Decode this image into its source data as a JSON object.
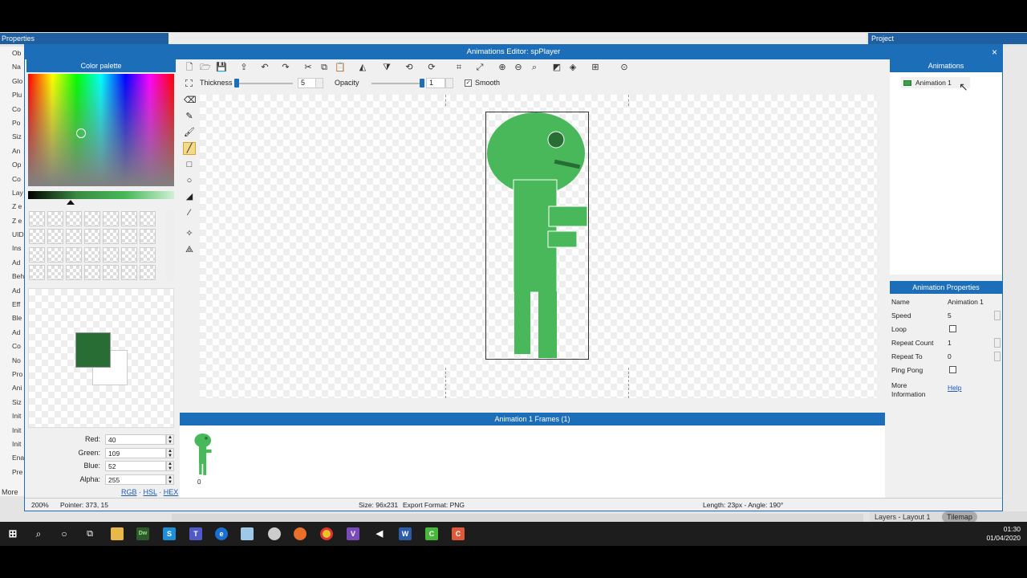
{
  "background": {
    "properties_title": "Properties",
    "project_title": "Project",
    "property_list": [
      "Ob",
      "Na",
      "Glo",
      "Plu",
      "Co",
      "Po",
      "Siz",
      "An",
      "Op",
      "Co",
      "Lay",
      "Z e",
      "Z e",
      "UID",
      "Ins",
      "Ad",
      "Beh",
      "Ad",
      "Eff",
      "Ble",
      "Ad",
      "Co",
      "No",
      "Pro",
      "Ani",
      "Siz",
      "Init",
      "Init",
      "Init",
      "Ena",
      "Pre"
    ],
    "more_label": "More",
    "layers_tab": "Layers - Layout 1",
    "tilemap_tab": "Tilemap"
  },
  "dialog": {
    "title": "Animations Editor: spPlayer",
    "close_glyph": "×"
  },
  "palette": {
    "title": "Color palette",
    "primary_color": "#286d34",
    "secondary_color": "#ffffff",
    "fields": [
      {
        "label": "Red:",
        "value": "40"
      },
      {
        "label": "Green:",
        "value": "109"
      },
      {
        "label": "Blue:",
        "value": "52"
      },
      {
        "label": "Alpha:",
        "value": "255"
      }
    ],
    "formats": [
      "RGB",
      "HSL",
      "HEX"
    ]
  },
  "options": {
    "thickness_label": "Thickness",
    "thickness_value": "5",
    "opacity_label": "Opacity",
    "opacity_value": "1",
    "smooth_label": "Smooth"
  },
  "sprite": {
    "body_color": "#48b85a",
    "eye_color": "#286d34"
  },
  "frames": {
    "title": "Animation 1 Frames (1)",
    "items": [
      {
        "index": "0"
      }
    ]
  },
  "animations": {
    "title": "Animations",
    "items": [
      "Animation 1"
    ]
  },
  "anim_props": {
    "title": "Animation Properties",
    "rows": {
      "name": {
        "label": "Name",
        "value": "Animation 1"
      },
      "speed": {
        "label": "Speed",
        "value": "5"
      },
      "loop": {
        "label": "Loop"
      },
      "repeat_count": {
        "label": "Repeat Count",
        "value": "1"
      },
      "repeat_to": {
        "label": "Repeat To",
        "value": "0"
      },
      "ping_pong": {
        "label": "Ping Pong"
      },
      "more_info": {
        "label_line1": "More",
        "label_line2": "Information",
        "value": "Help"
      }
    }
  },
  "status": {
    "zoom": "200%",
    "pointer": "Pointer: 373, 15",
    "size": "Size: 96x231",
    "export": "Export Format: PNG",
    "length": "Length: 23px - Angle: 190°"
  },
  "taskbar": {
    "time": "01:30",
    "date": "01/04/2020"
  }
}
